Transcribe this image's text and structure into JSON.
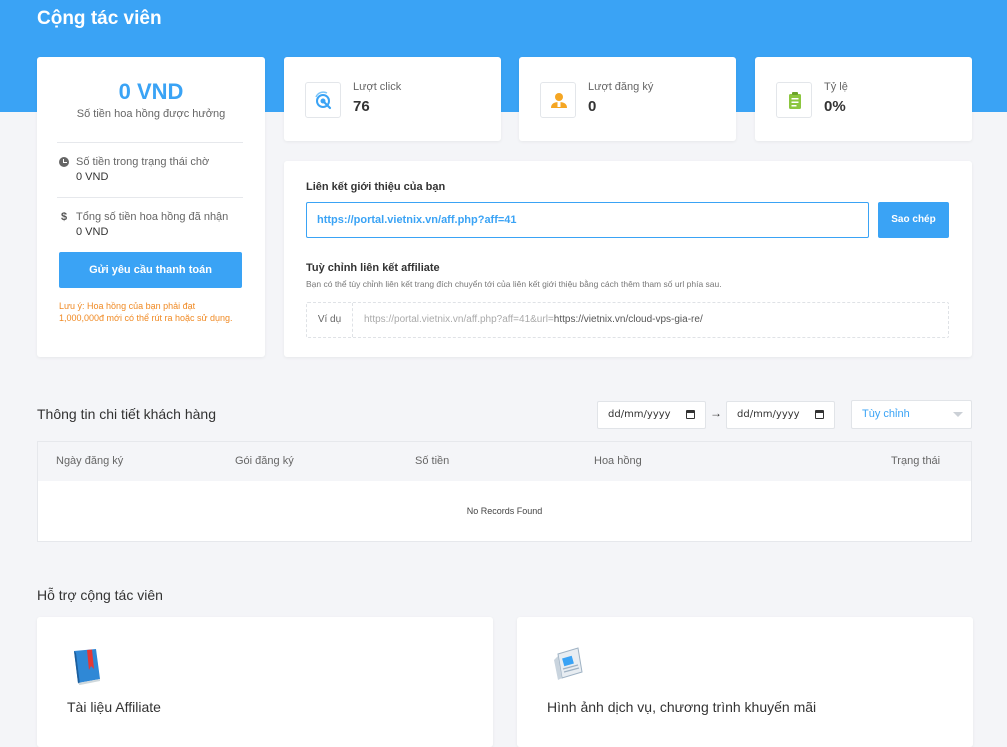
{
  "page": {
    "title": "Cộng tác viên"
  },
  "commission": {
    "amount": "0 VND",
    "subtitle": "Số tiền hoa hồng được hưởng",
    "pending_label": "Số tiền trong trạng thái chờ",
    "pending_value": "0 VND",
    "received_label": "Tổng số tiền hoa hồng đã nhận",
    "received_value": "0 VND",
    "received_icon": "$",
    "pay_button": "Gửi yêu cầu thanh toán",
    "note_line1": "Lưu ý: Hoa hồng của bạn phải đạt",
    "note_line2": "1,000,000đ mới có thể rút ra hoặc sử dụng."
  },
  "stats": [
    {
      "label": "Lượt click",
      "value": "76",
      "icon": "click-icon"
    },
    {
      "label": "Lượt đăng ký",
      "value": "0",
      "icon": "user-icon"
    },
    {
      "label": "Tỷ lệ",
      "value": "0%",
      "icon": "clipboard-icon"
    }
  ],
  "referral": {
    "title": "Liên kết giới thiệu của bạn",
    "link": "https://portal.vietnix.vn/aff.php?aff=41",
    "copy_button": "Sao chép",
    "custom_title": "Tuỳ chỉnh liên kết affiliate",
    "custom_desc": "Bạn có thể tùy chỉnh liên kết trang đích chuyển tới của liên kết giới thiệu bằng cách thêm tham số url phía sau.",
    "example_label": "Ví dụ",
    "example_prefix": "https://portal.vietnix.vn/aff.php?aff=41&url=",
    "example_suffix": "https://vietnix.vn/cloud-vps-gia-re/"
  },
  "customers": {
    "title": "Thông tin chi tiết khách hàng",
    "date_from": "dd/mm/yyyy",
    "date_to": "dd/mm/yyyy",
    "arrow": "→",
    "range_select": "Tùy chỉnh",
    "columns": [
      "Ngày đăng ký",
      "Gói đăng ký",
      "Số tiền",
      "Hoa hồng",
      "Trạng thái"
    ],
    "empty": "No Records Found"
  },
  "support": {
    "title": "Hỗ trợ cộng tác viên",
    "cards": [
      {
        "title": "Tài liệu Affiliate",
        "icon": "book-icon"
      },
      {
        "title": "Hình ảnh dịch vụ, chương trình khuyến mãi",
        "icon": "newspaper-icon"
      }
    ]
  },
  "colors": {
    "accent": "#3aa3f5",
    "warning": "#f08a24",
    "background": "#f4f5f8"
  }
}
